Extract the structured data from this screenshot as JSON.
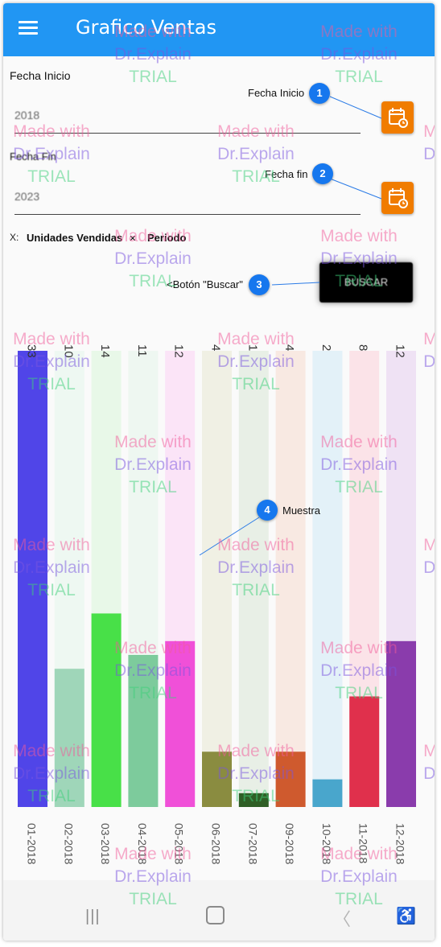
{
  "appbar": {
    "title": "Grafico Ventas"
  },
  "form": {
    "start_label": "Fecha Inicio",
    "start_value": "2018",
    "end_label": "Fecha Fin",
    "end_value": "2023",
    "x_prefix": "X:",
    "chip_units": "Unidades Vendidas",
    "chip_period": "Periodo",
    "chip_remove": "✕",
    "search_button": "BUSCAR"
  },
  "callouts": [
    {
      "number": "1",
      "text": "Fecha Inicio"
    },
    {
      "number": "2",
      "text": "Fecha fin"
    },
    {
      "number": "3",
      "text": "<Botón \"Buscar\""
    },
    {
      "number": "4",
      "text": "Muestra"
    }
  ],
  "watermark": {
    "line1": "Made with",
    "line2": "Dr.Explain",
    "line3": "TRIAL"
  },
  "chart_data": {
    "type": "bar",
    "categories": [
      "01-2018",
      "02-2018",
      "03-2018",
      "04-2018",
      "05-2018",
      "06-2018",
      "07-2018",
      "09-2018",
      "10-2018",
      "11-2018",
      "12-2018"
    ],
    "values": [
      33,
      10,
      14,
      11,
      12,
      4,
      1,
      4,
      2,
      8,
      12
    ],
    "ylim": [
      0,
      33
    ],
    "colors": [
      "#5045e8",
      "#9fd6b9",
      "#48e048",
      "#7dcb9c",
      "#f050d8",
      "#8a8c40",
      "#2f5f26",
      "#cf5a2e",
      "#49a6cc",
      "#e0304c",
      "#8a3cac"
    ],
    "bg_colors": [
      "#dedcf6",
      "#eef8f2",
      "#e8f8e8",
      "#eef7f1",
      "#fbe4f7",
      "#f0f0e4",
      "#e8efe6",
      "#f8e9e2",
      "#e3f1f8",
      "#fbe3e8",
      "#efe2f4"
    ],
    "grid": false,
    "legend": "none"
  },
  "navbar": {
    "recent": "|||",
    "home": "▢",
    "back": "〈",
    "accessibility": "♿"
  }
}
